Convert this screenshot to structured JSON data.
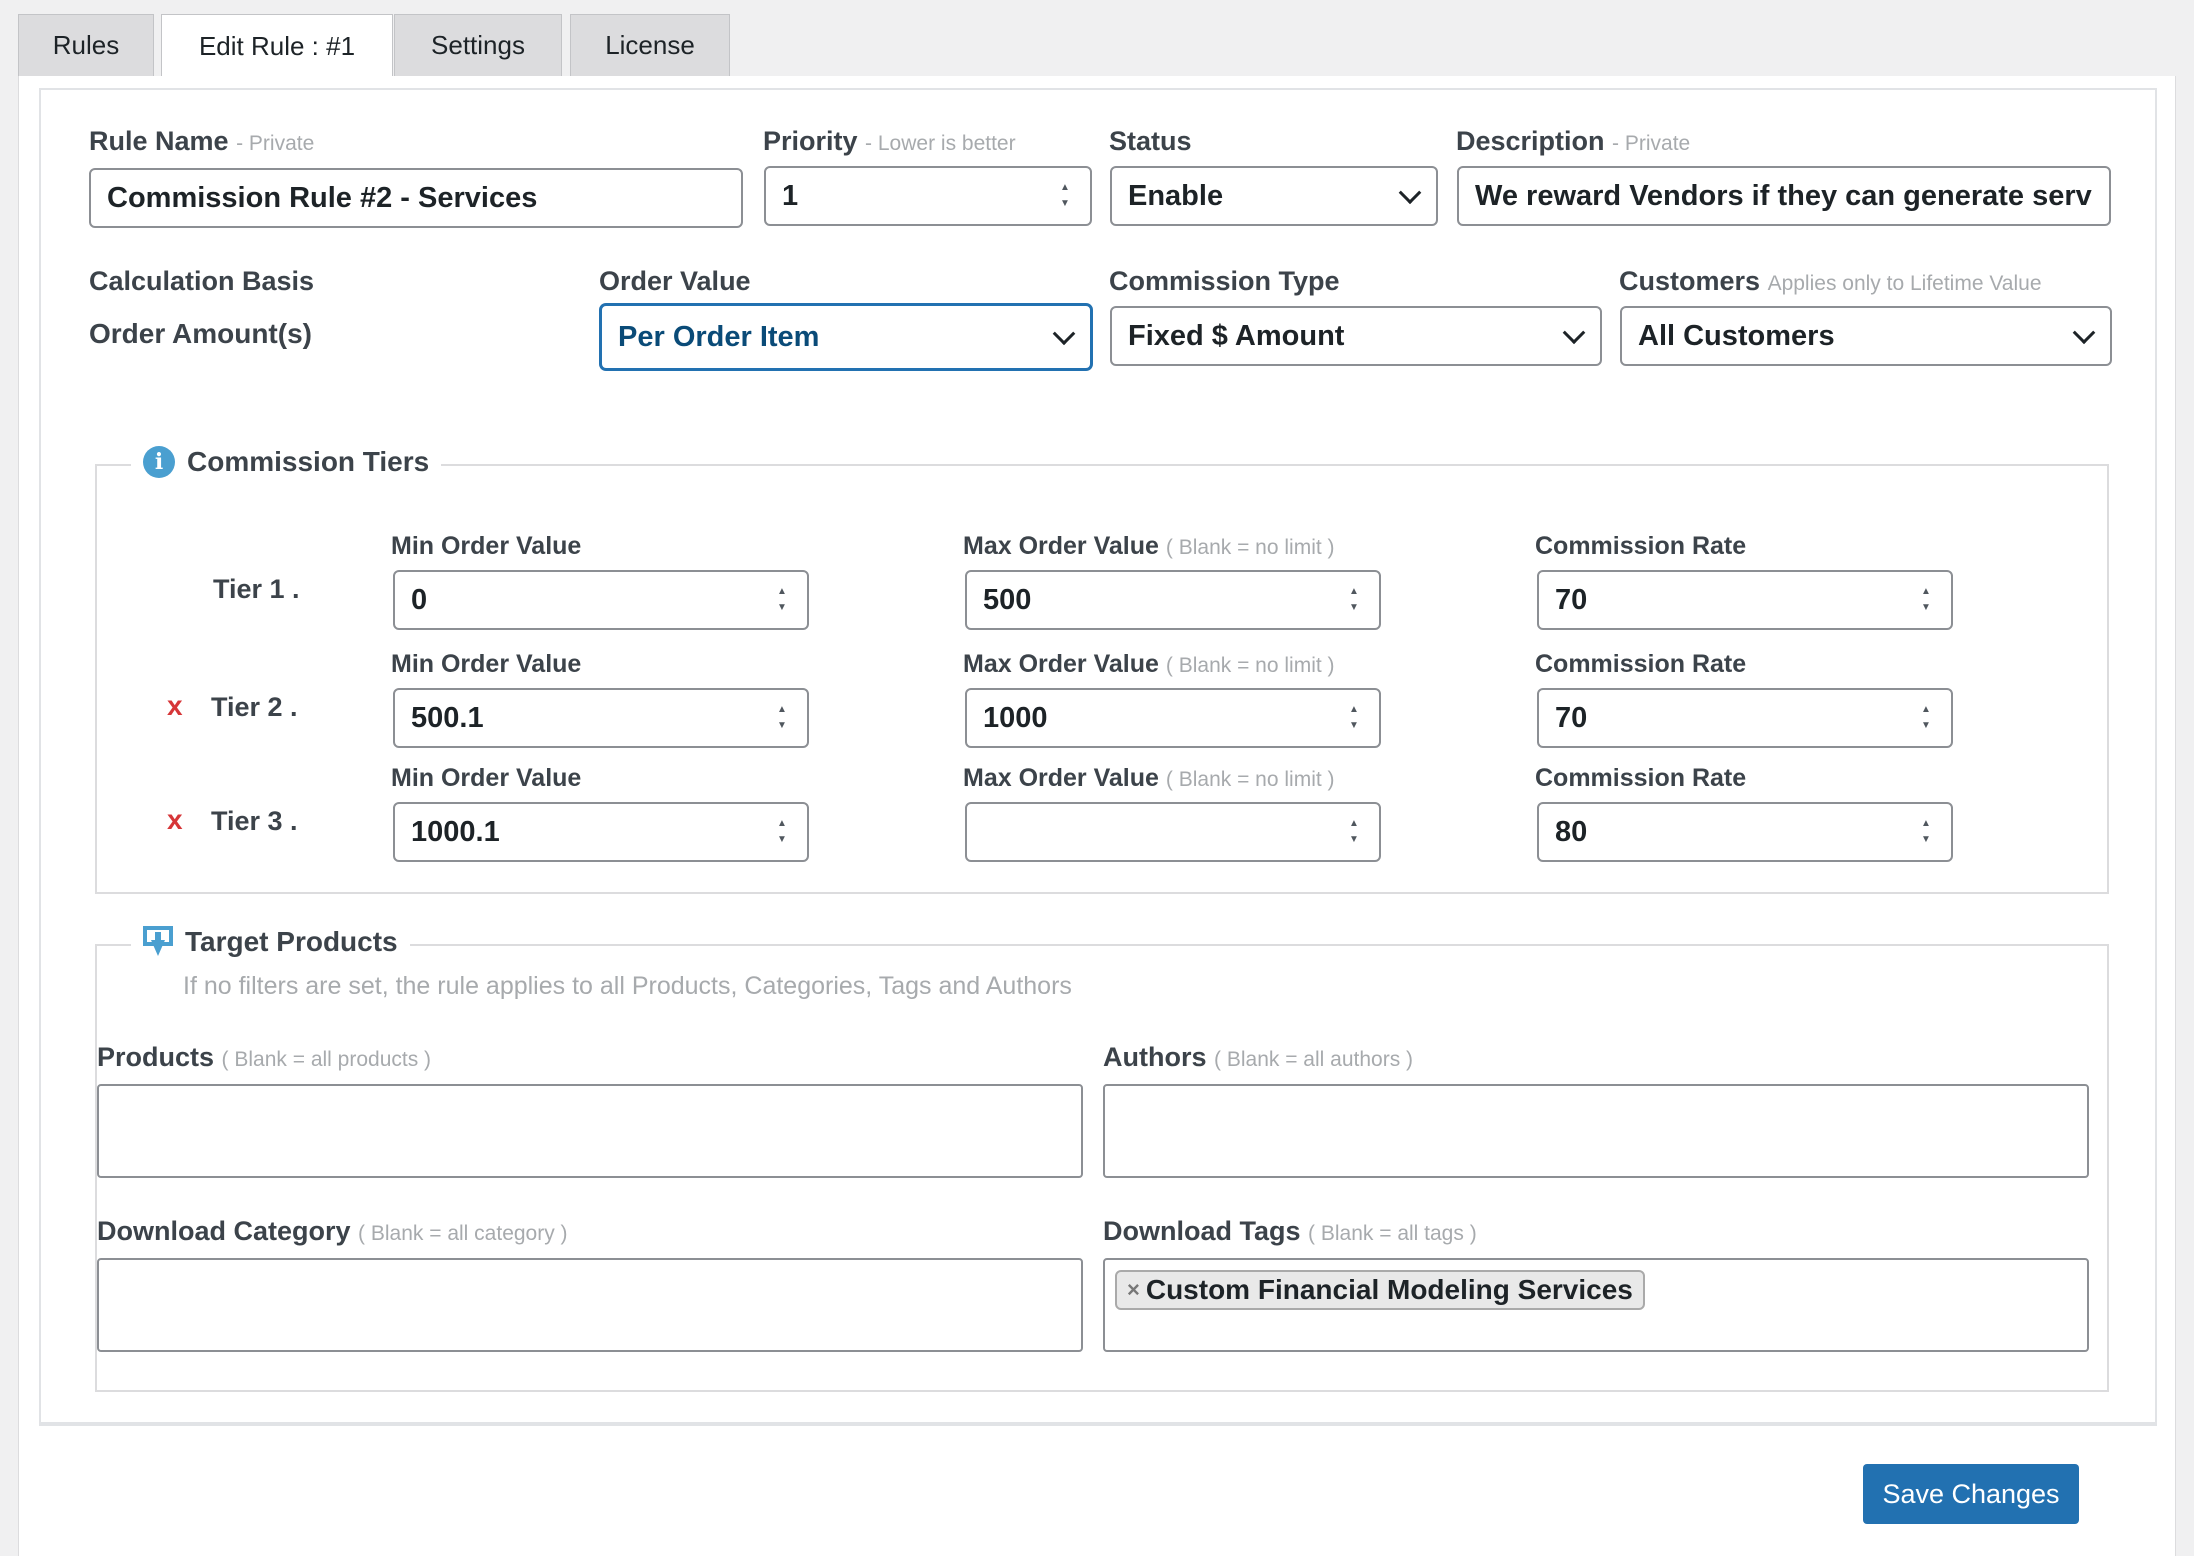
{
  "tabs": [
    {
      "label": "Rules"
    },
    {
      "label": "Edit Rule : #1"
    },
    {
      "label": "Settings"
    },
    {
      "label": "License"
    }
  ],
  "rule_name": {
    "label": "Rule Name",
    "hint": "- Private",
    "value": "Commission Rule #2 - Services"
  },
  "priority": {
    "label": "Priority",
    "hint": "- Lower is better",
    "value": "1"
  },
  "status": {
    "label": "Status",
    "value": "Enable"
  },
  "description": {
    "label": "Description",
    "hint": "- Private",
    "value": "We reward Vendors if they can generate serv"
  },
  "calc_basis": {
    "label": "Calculation Basis",
    "value": "Order Amount(s)"
  },
  "order_value": {
    "label": "Order Value",
    "value": "Per Order Item"
  },
  "commission_type": {
    "label": "Commission Type",
    "value": "Fixed $ Amount"
  },
  "customers": {
    "label": "Customers",
    "hint": "Applies only to Lifetime Value",
    "value": "All Customers"
  },
  "tiers": {
    "legend": "Commission Tiers",
    "remove_symbol": "x",
    "min_label": "Min Order Value",
    "max_label": "Max Order Value",
    "max_hint": "( Blank = no limit )",
    "rate_label": "Commission Rate",
    "rows": [
      {
        "label": "Tier 1 .",
        "min": "0",
        "max": "500",
        "rate": "70"
      },
      {
        "label": "Tier 2 .",
        "min": "500.1",
        "max": "1000",
        "rate": "70"
      },
      {
        "label": "Tier 3 .",
        "min": "1000.1",
        "max": "",
        "rate": "80"
      }
    ]
  },
  "target": {
    "legend": "Target Products",
    "note": "If no filters are set, the rule applies to all Products, Categories, Tags and Authors",
    "products": {
      "label": "Products",
      "hint": "( Blank = all products )"
    },
    "authors": {
      "label": "Authors",
      "hint": "( Blank = all authors )"
    },
    "category": {
      "label": "Download Category",
      "hint": "( Blank = all category )"
    },
    "tags": {
      "label": "Download Tags",
      "hint": "( Blank = all tags )",
      "chip": "Custom Financial Modeling Services",
      "chip_remove": "×"
    }
  },
  "save_label": "Save Changes",
  "colors": {
    "accent": "#2271b1",
    "remove": "#d63638",
    "info": "#4a9fd0"
  }
}
